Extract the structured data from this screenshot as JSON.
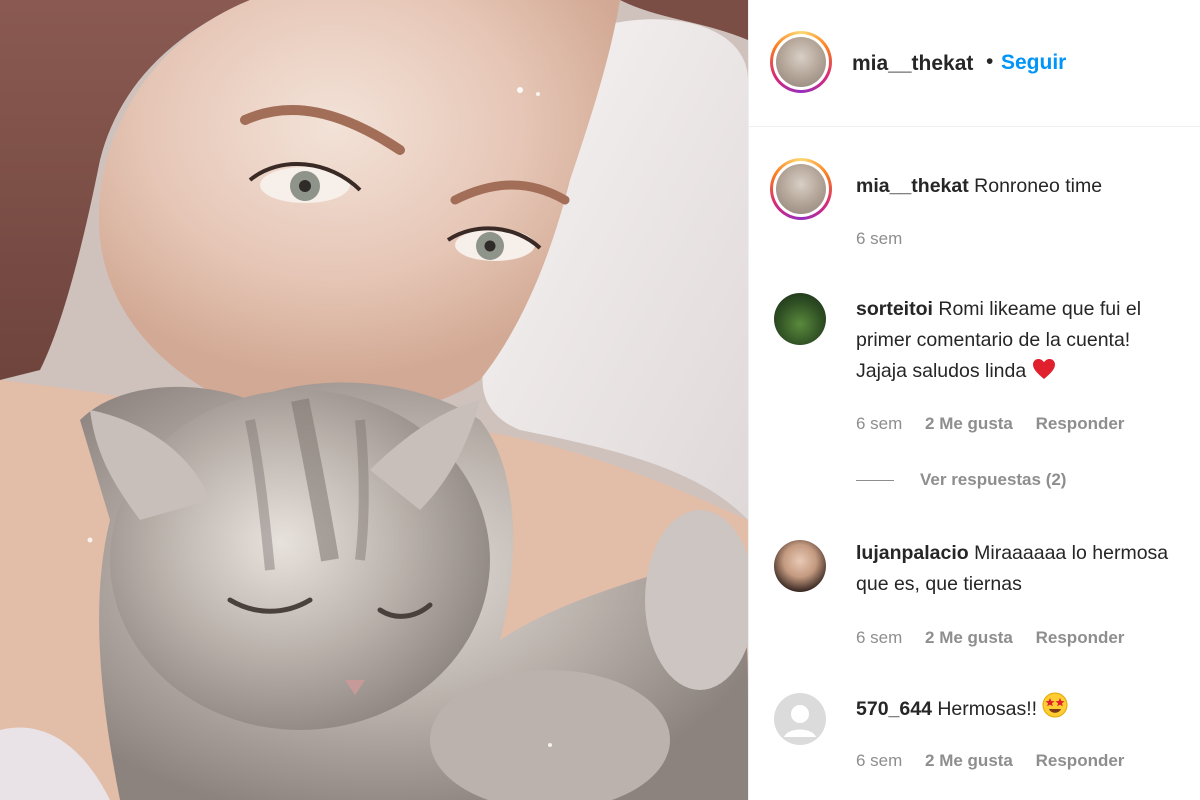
{
  "post": {
    "photo_alt": "Selfie with sleeping kitten",
    "author": {
      "username": "mia__thekat",
      "separator": "•",
      "follow_label": "Seguir"
    },
    "caption": {
      "username": "mia__thekat",
      "text": "Ronroneo time",
      "time": "6 sem"
    },
    "comments": [
      {
        "username": "sorteitoi",
        "text": "Romi likeame que fui el primer comentario de la cuenta! Jajaja saludos linda",
        "emoji": "red-heart",
        "time": "6 sem",
        "likes": "2 Me gusta",
        "reply": "Responder",
        "view_replies": "Ver respuestas (2)"
      },
      {
        "username": "lujanpalacio",
        "text": "Miraaaaaa lo hermosa que es, que tiernas",
        "time": "6 sem",
        "likes": "2 Me gusta",
        "reply": "Responder"
      },
      {
        "username": "570_644",
        "text": "Hermosas!!",
        "emoji": "star-struck",
        "time": "6 sem",
        "likes": "2 Me gusta",
        "reply": "Responder"
      }
    ]
  },
  "colors": {
    "link_blue": "#0095f6",
    "secondary_text": "#8e8e8e",
    "primary_text": "#262626"
  }
}
